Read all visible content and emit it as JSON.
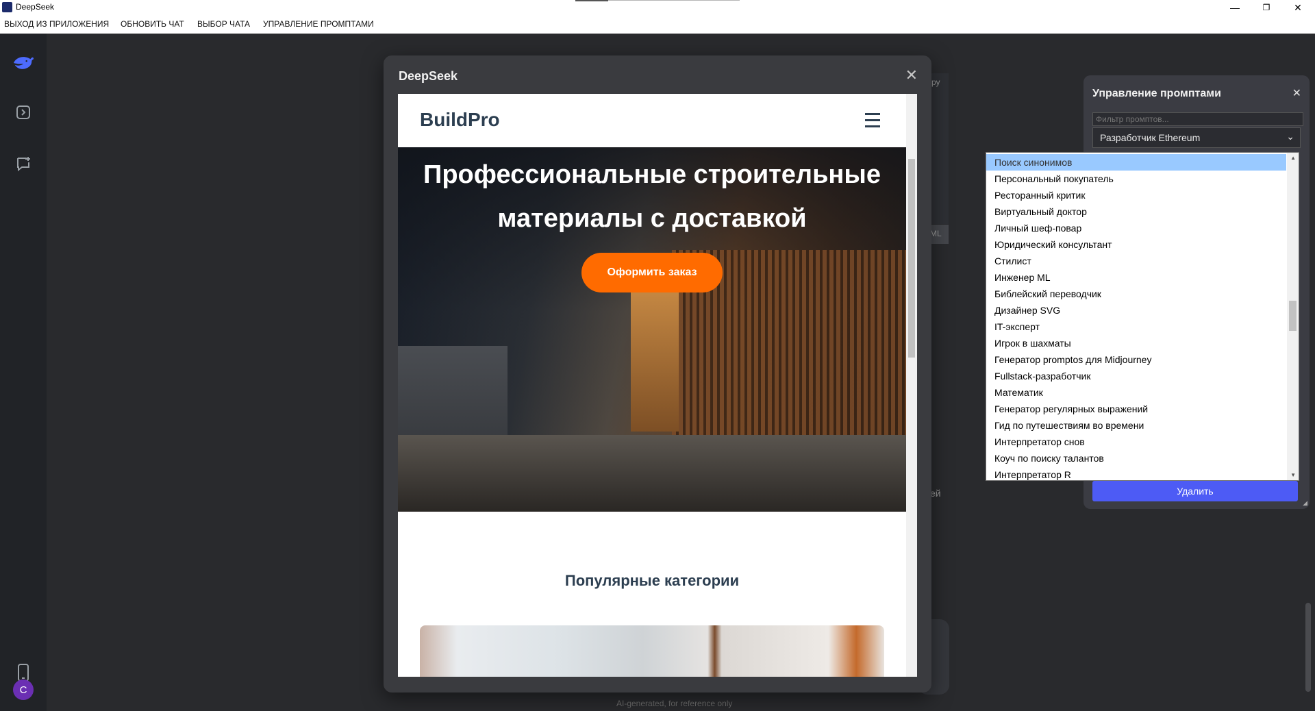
{
  "window": {
    "title": "DeepSeek",
    "controls": [
      "—",
      "❐",
      "✕"
    ]
  },
  "menu": [
    {
      "label": "ВЫХОД ИЗ ПРИЛОЖЕНИЯ"
    },
    {
      "label": "ОБНОВИТЬ ЧАТ"
    },
    {
      "label": "ВЫБОР ЧАТА"
    },
    {
      "label": "УПРАВЛЕНИЕ ПРОМПТАМИ"
    }
  ],
  "sidebar": {
    "avatar_letter": "C",
    "accent": "#4d6bfe"
  },
  "background": {
    "fragment_top": "ру",
    "fragment_ml": "ML",
    "fragment_right": "ей",
    "disclaimer": "AI-generated, for reference only"
  },
  "modal": {
    "title": "DeepSeek",
    "close": "✕",
    "site": {
      "brand": "BuildPro",
      "hero_title": "Профессиональные строительные материалы с доставкой",
      "hero_button": "Оформить заказ",
      "section_title": "Популярные категории"
    }
  },
  "prompt_panel": {
    "title": "Управление промптами",
    "close": "✕",
    "filter_placeholder": "Фильтр промптов...",
    "selected": "Разработчик Ethereum",
    "delete_label": "Удалить",
    "options": [
      "Поиск синонимов",
      "Персональный покупатель",
      "Ресторанный критик",
      "Виртуальный доктор",
      "Личный шеф-повар",
      "Юридический консультант",
      "Стилист",
      "Инженер ML",
      "Библейский переводчик",
      "Дизайнер SVG",
      "IT-эксперт",
      "Игрок в шахматы",
      "Генератор promptos для Midjourney",
      "Fullstack-разработчик",
      "Математик",
      "Генератор регулярных выражений",
      "Гид по путешествиям во времени",
      "Интерпретатор снов",
      "Коуч по поиску талантов",
      "Интерпретатор R"
    ],
    "highlighted_index": 0
  }
}
